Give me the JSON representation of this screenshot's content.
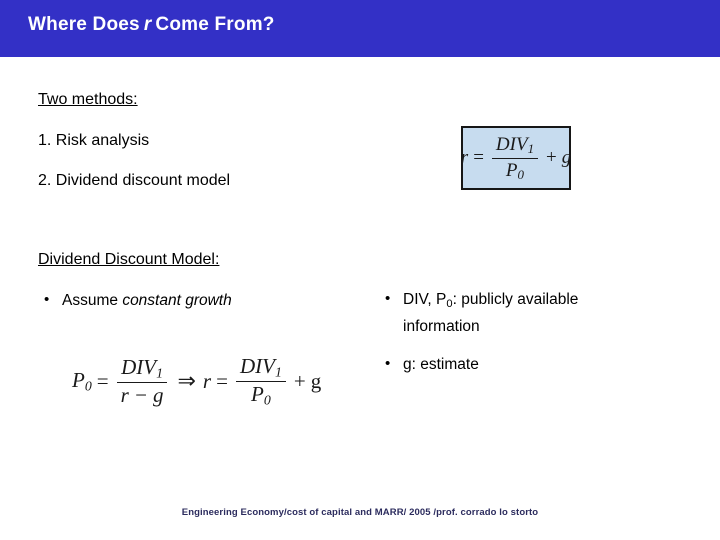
{
  "slide": {
    "title_prefix": "Where Does",
    "title_variable": "r",
    "title_suffix": "Come From?",
    "banner_color": "#3330c6",
    "banner_text_color": "#ffffff"
  },
  "content": {
    "methods_heading": "Two methods:",
    "method_1": "1. Risk analysis",
    "method_2": "2. Dividend discount model",
    "ddm_heading": "Dividend Discount Model:"
  },
  "bullets": {
    "assume_prefix": "Assume ",
    "assume_italic": "constant growth",
    "div_text_pre": "DIV, P",
    "div_sub": "0",
    "div_text_post": ": publicly available information",
    "g_text": "g: estimate",
    "marker": "•"
  },
  "formula_box": {
    "lhs": "r",
    "equals": "=",
    "numerator": "DIV",
    "numerator_sub": "1",
    "denominator": "P",
    "denominator_sub": "0",
    "plus": "+",
    "addend": "g",
    "fill_color": "#c7dcef",
    "border_color": "#161616"
  },
  "derivation": {
    "lhs": "P",
    "lhs_sub": "0",
    "equals_1": "=",
    "num_1": "DIV",
    "num_1_sub": "1",
    "den_1_a": "r",
    "den_1_minus": "−",
    "den_1_b": "g",
    "implies": "⇒",
    "rhs_var": "r",
    "equals_2": "=",
    "num_2": "DIV",
    "num_2_sub": "1",
    "den_2": "P",
    "den_2_sub": "0",
    "plus": "+",
    "addend": "g"
  },
  "footer": {
    "text": "Engineering Economy/cost of capital and MARR/ 2005 /prof. corrado lo storto",
    "color": "#2c2c5e"
  }
}
